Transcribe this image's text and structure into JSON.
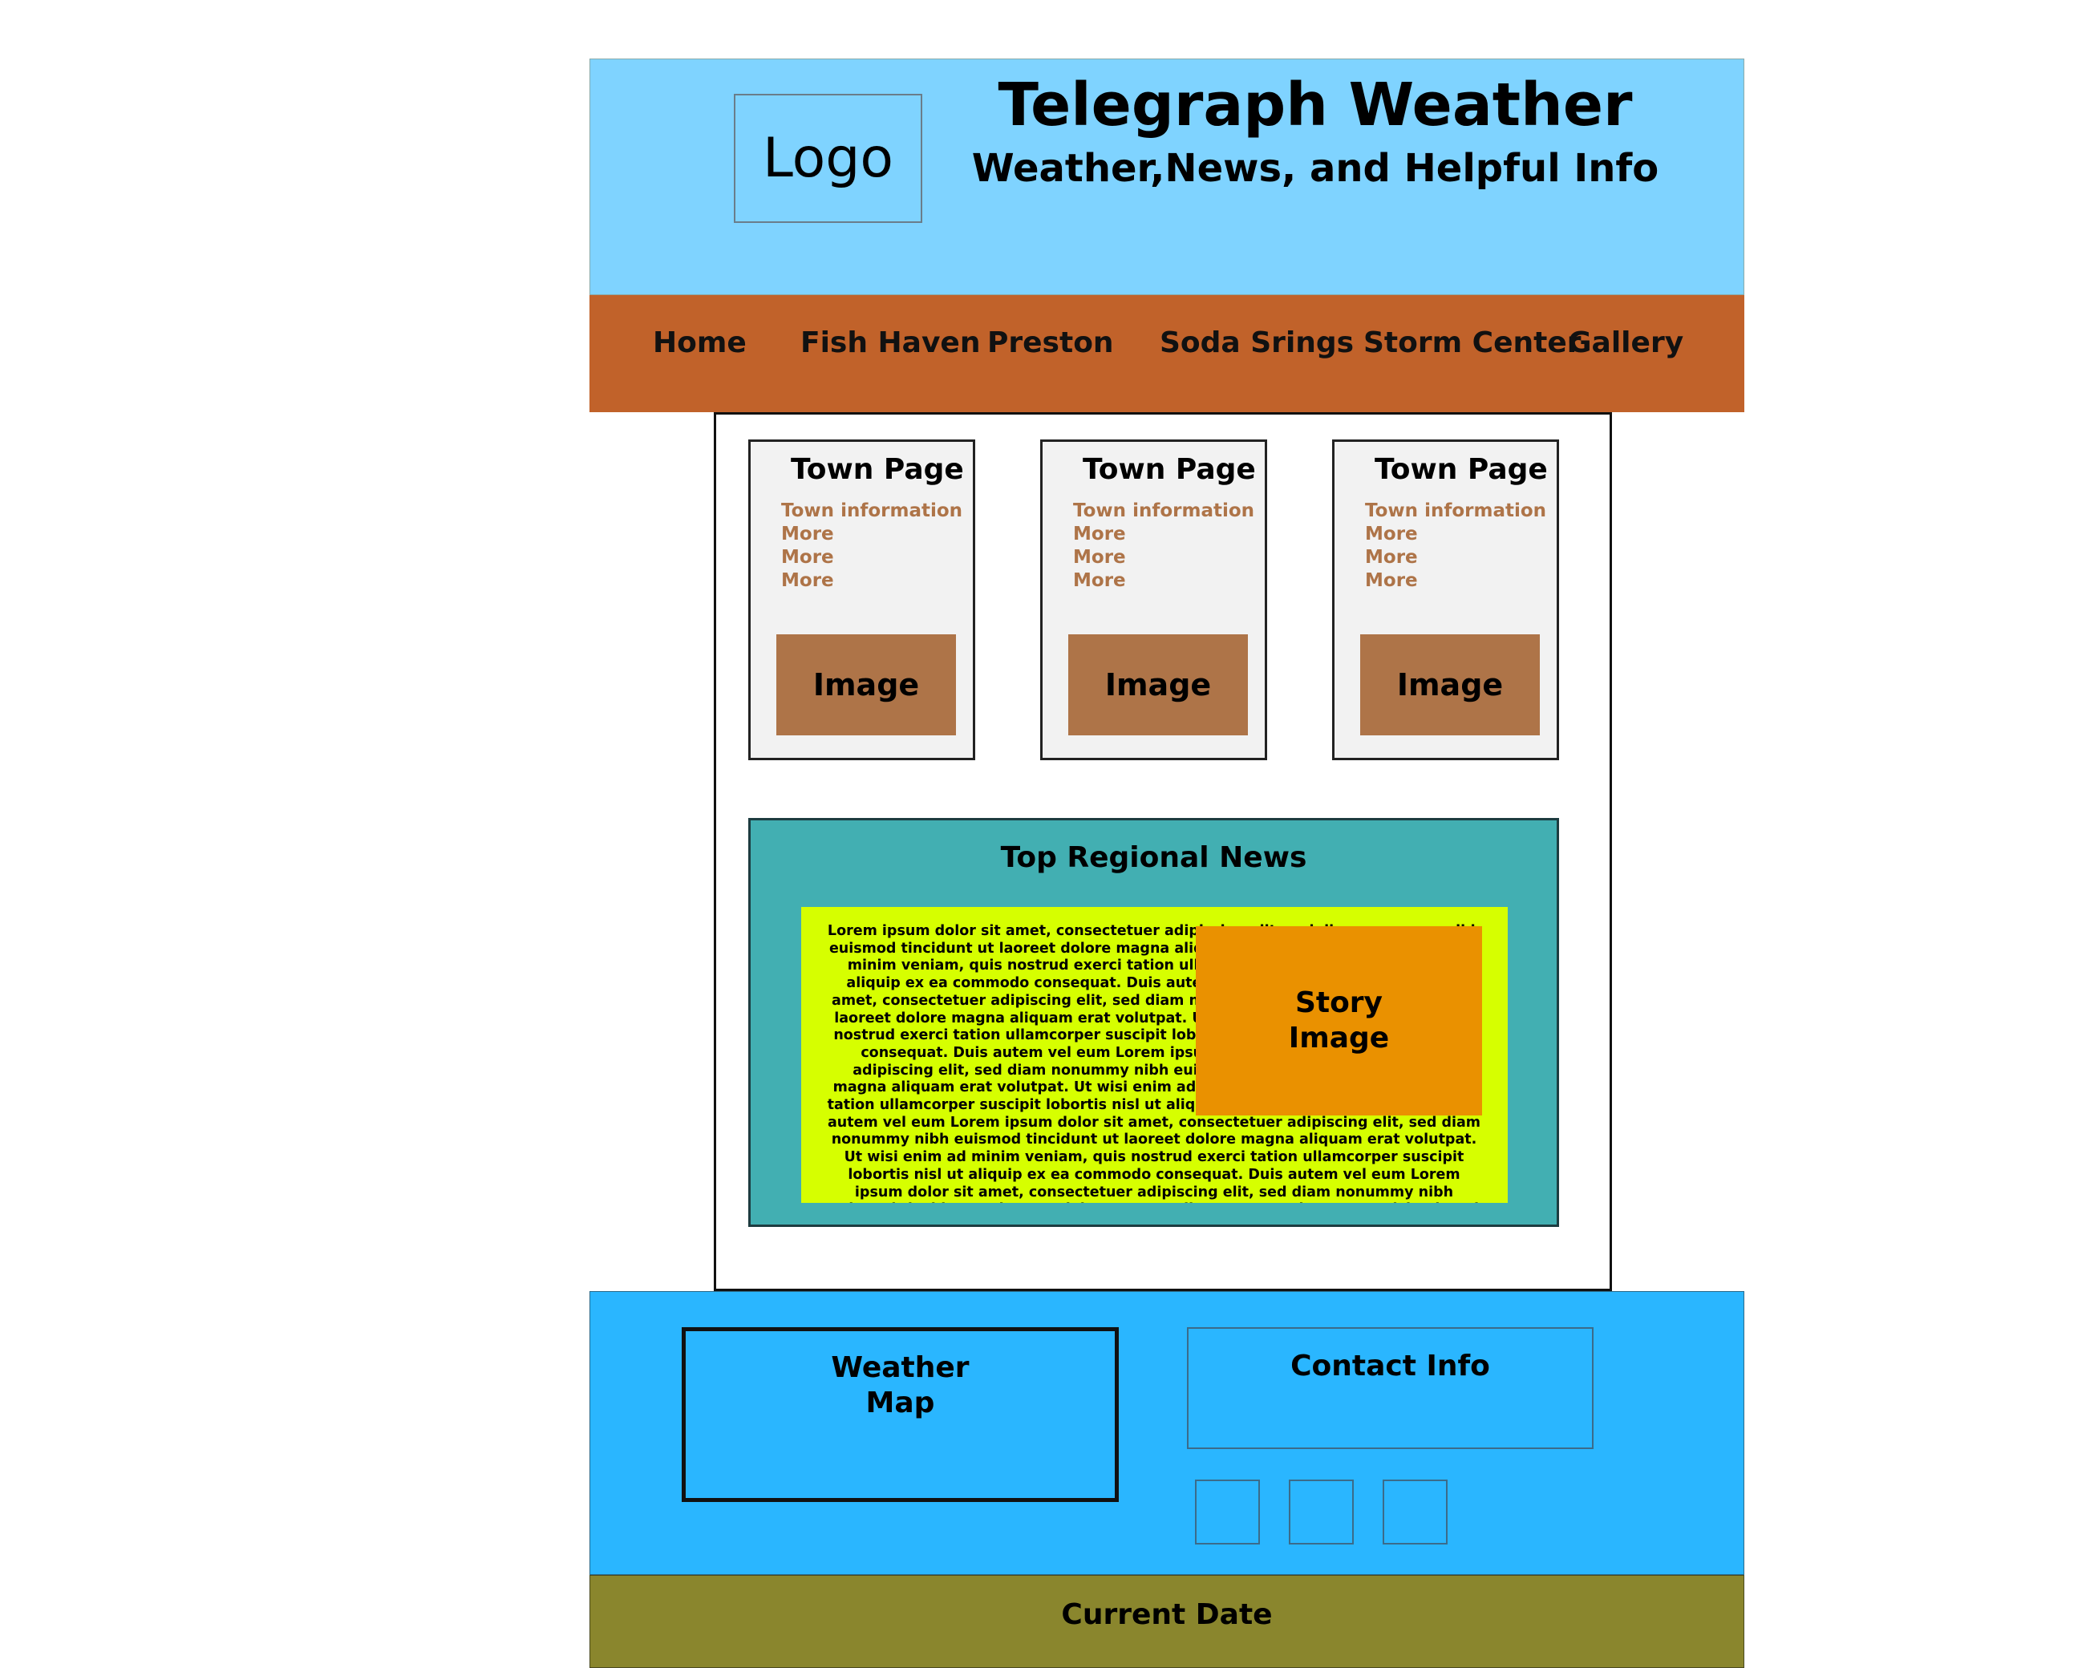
{
  "header": {
    "logo": "Logo",
    "title": "Telegraph Weather",
    "subtitle": "Weather,News, and Helpful Info"
  },
  "nav": {
    "items": [
      "Home",
      "Fish Haven",
      "Preston",
      "Soda Srings",
      "Storm Center",
      "Gallery"
    ]
  },
  "towns": [
    {
      "title": "Town Page",
      "links": [
        "Town information",
        "More",
        "More",
        "More"
      ],
      "image": "Image"
    },
    {
      "title": "Town Page",
      "links": [
        "Town information",
        "More",
        "More",
        "More"
      ],
      "image": "Image"
    },
    {
      "title": "Town Page",
      "links": [
        "Town information",
        "More",
        "More",
        "More"
      ],
      "image": "Image"
    }
  ],
  "news": {
    "title": "Top Regional News",
    "story_image": "Story\nImage",
    "text": "Lorem ipsum dolor sit amet, consectetuer adipiscing elit, sed diam nonummy nibh euismod tincidunt ut laoreet dolore magna aliquam erat volutpat. Ut wisi enim ad minim veniam, quis nostrud exerci tation ullamcorper suscipit lobortis nisl ut aliquip ex ea commodo consequat. Duis autem vel eum Lorem ipsum dolor sit amet, consectetuer adipiscing elit, sed diam nonummy nibh euismod tincidunt ut laoreet dolore magna aliquam erat volutpat. Ut wisi enim ad minim veniam, quis nostrud exerci tation ullamcorper suscipit lobortis nisl ut aliquip ex ea commodo consequat. Duis autem vel eum Lorem ipsum dolor sit amet, consectetuer adipiscing elit, sed diam nonummy nibh euismod tincidunt ut laoreet dolore magna aliquam erat volutpat. Ut wisi enim ad minim veniam, quis nostrud exerci tation ullamcorper suscipit lobortis nisl ut aliquip ex ea commodo consequat. Duis autem vel eum Lorem ipsum dolor sit amet, consectetuer adipiscing elit, sed diam nonummy nibh euismod tincidunt ut laoreet dolore magna aliquam erat volutpat. Ut wisi enim ad minim veniam, quis nostrud exerci tation ullamcorper suscipit lobortis nisl ut aliquip ex ea commodo consequat. Duis autem vel eum Lorem ipsum dolor sit amet, consectetuer adipiscing elit, sed diam nonummy nibh euismod tincidunt ut laoreet dolore magna aliquam erat volutpat. Ut wisi enim ad minim veniam, quis nostrud"
  },
  "footer": {
    "weather_map": "Weather\nMap",
    "contact": "Contact Info",
    "current_date": "Current Date"
  }
}
